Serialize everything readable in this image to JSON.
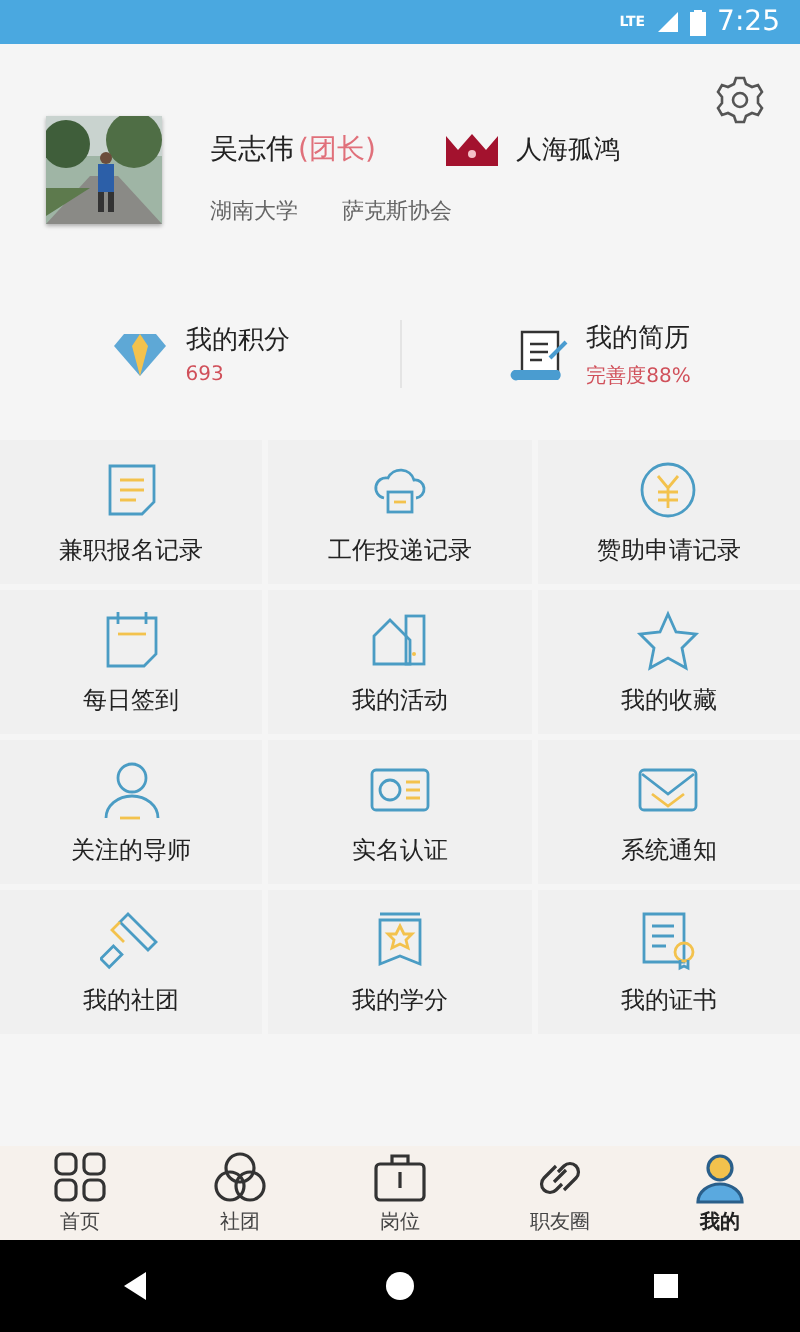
{
  "status_bar": {
    "network": "LTE",
    "time": "7:25"
  },
  "profile": {
    "name": "吴志伟",
    "role": "(团长)",
    "nickname": "人海孤鸿",
    "school": "湖南大学",
    "club": "萨克斯协会"
  },
  "stats": [
    {
      "kind": "points",
      "title": "我的积分",
      "value": "693"
    },
    {
      "kind": "resume",
      "title": "我的简历",
      "value": "完善度88%"
    }
  ],
  "menu": [
    {
      "kind": "note",
      "label": "兼职报名记录"
    },
    {
      "kind": "cloud",
      "label": "工作投递记录"
    },
    {
      "kind": "yuan",
      "label": "赞助申请记录"
    },
    {
      "kind": "calendar",
      "label": "每日签到"
    },
    {
      "kind": "activity",
      "label": "我的活动"
    },
    {
      "kind": "star",
      "label": "我的收藏"
    },
    {
      "kind": "person",
      "label": "关注的导师"
    },
    {
      "kind": "idcard",
      "label": "实名认证"
    },
    {
      "kind": "mail",
      "label": "系统通知"
    },
    {
      "kind": "roller",
      "label": "我的社团"
    },
    {
      "kind": "badge",
      "label": "我的学分"
    },
    {
      "kind": "certificate",
      "label": "我的证书"
    }
  ],
  "tab_bar": [
    {
      "kind": "home",
      "label": "首页",
      "selected": false
    },
    {
      "kind": "club",
      "label": "社团",
      "selected": false
    },
    {
      "kind": "job",
      "label": "岗位",
      "selected": false
    },
    {
      "kind": "friends",
      "label": "职友圈",
      "selected": false
    },
    {
      "kind": "me",
      "label": "我的",
      "selected": true
    }
  ]
}
